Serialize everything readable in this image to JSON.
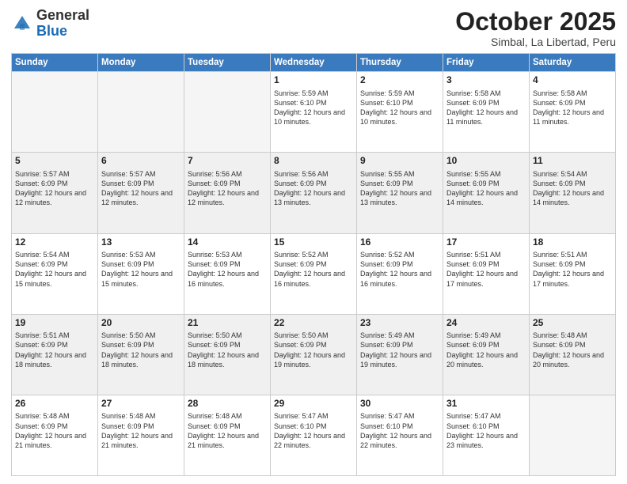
{
  "logo": {
    "general": "General",
    "blue": "Blue"
  },
  "header": {
    "month_year": "October 2025",
    "location": "Simbal, La Libertad, Peru"
  },
  "weekdays": [
    "Sunday",
    "Monday",
    "Tuesday",
    "Wednesday",
    "Thursday",
    "Friday",
    "Saturday"
  ],
  "weeks": [
    {
      "shade": false,
      "days": [
        {
          "num": "",
          "info": ""
        },
        {
          "num": "",
          "info": ""
        },
        {
          "num": "",
          "info": ""
        },
        {
          "num": "1",
          "info": "Sunrise: 5:59 AM\nSunset: 6:10 PM\nDaylight: 12 hours\nand 10 minutes."
        },
        {
          "num": "2",
          "info": "Sunrise: 5:59 AM\nSunset: 6:10 PM\nDaylight: 12 hours\nand 10 minutes."
        },
        {
          "num": "3",
          "info": "Sunrise: 5:58 AM\nSunset: 6:09 PM\nDaylight: 12 hours\nand 11 minutes."
        },
        {
          "num": "4",
          "info": "Sunrise: 5:58 AM\nSunset: 6:09 PM\nDaylight: 12 hours\nand 11 minutes."
        }
      ]
    },
    {
      "shade": true,
      "days": [
        {
          "num": "5",
          "info": "Sunrise: 5:57 AM\nSunset: 6:09 PM\nDaylight: 12 hours\nand 12 minutes."
        },
        {
          "num": "6",
          "info": "Sunrise: 5:57 AM\nSunset: 6:09 PM\nDaylight: 12 hours\nand 12 minutes."
        },
        {
          "num": "7",
          "info": "Sunrise: 5:56 AM\nSunset: 6:09 PM\nDaylight: 12 hours\nand 12 minutes."
        },
        {
          "num": "8",
          "info": "Sunrise: 5:56 AM\nSunset: 6:09 PM\nDaylight: 12 hours\nand 13 minutes."
        },
        {
          "num": "9",
          "info": "Sunrise: 5:55 AM\nSunset: 6:09 PM\nDaylight: 12 hours\nand 13 minutes."
        },
        {
          "num": "10",
          "info": "Sunrise: 5:55 AM\nSunset: 6:09 PM\nDaylight: 12 hours\nand 14 minutes."
        },
        {
          "num": "11",
          "info": "Sunrise: 5:54 AM\nSunset: 6:09 PM\nDaylight: 12 hours\nand 14 minutes."
        }
      ]
    },
    {
      "shade": false,
      "days": [
        {
          "num": "12",
          "info": "Sunrise: 5:54 AM\nSunset: 6:09 PM\nDaylight: 12 hours\nand 15 minutes."
        },
        {
          "num": "13",
          "info": "Sunrise: 5:53 AM\nSunset: 6:09 PM\nDaylight: 12 hours\nand 15 minutes."
        },
        {
          "num": "14",
          "info": "Sunrise: 5:53 AM\nSunset: 6:09 PM\nDaylight: 12 hours\nand 16 minutes."
        },
        {
          "num": "15",
          "info": "Sunrise: 5:52 AM\nSunset: 6:09 PM\nDaylight: 12 hours\nand 16 minutes."
        },
        {
          "num": "16",
          "info": "Sunrise: 5:52 AM\nSunset: 6:09 PM\nDaylight: 12 hours\nand 16 minutes."
        },
        {
          "num": "17",
          "info": "Sunrise: 5:51 AM\nSunset: 6:09 PM\nDaylight: 12 hours\nand 17 minutes."
        },
        {
          "num": "18",
          "info": "Sunrise: 5:51 AM\nSunset: 6:09 PM\nDaylight: 12 hours\nand 17 minutes."
        }
      ]
    },
    {
      "shade": true,
      "days": [
        {
          "num": "19",
          "info": "Sunrise: 5:51 AM\nSunset: 6:09 PM\nDaylight: 12 hours\nand 18 minutes."
        },
        {
          "num": "20",
          "info": "Sunrise: 5:50 AM\nSunset: 6:09 PM\nDaylight: 12 hours\nand 18 minutes."
        },
        {
          "num": "21",
          "info": "Sunrise: 5:50 AM\nSunset: 6:09 PM\nDaylight: 12 hours\nand 18 minutes."
        },
        {
          "num": "22",
          "info": "Sunrise: 5:50 AM\nSunset: 6:09 PM\nDaylight: 12 hours\nand 19 minutes."
        },
        {
          "num": "23",
          "info": "Sunrise: 5:49 AM\nSunset: 6:09 PM\nDaylight: 12 hours\nand 19 minutes."
        },
        {
          "num": "24",
          "info": "Sunrise: 5:49 AM\nSunset: 6:09 PM\nDaylight: 12 hours\nand 20 minutes."
        },
        {
          "num": "25",
          "info": "Sunrise: 5:48 AM\nSunset: 6:09 PM\nDaylight: 12 hours\nand 20 minutes."
        }
      ]
    },
    {
      "shade": false,
      "days": [
        {
          "num": "26",
          "info": "Sunrise: 5:48 AM\nSunset: 6:09 PM\nDaylight: 12 hours\nand 21 minutes."
        },
        {
          "num": "27",
          "info": "Sunrise: 5:48 AM\nSunset: 6:09 PM\nDaylight: 12 hours\nand 21 minutes."
        },
        {
          "num": "28",
          "info": "Sunrise: 5:48 AM\nSunset: 6:09 PM\nDaylight: 12 hours\nand 21 minutes."
        },
        {
          "num": "29",
          "info": "Sunrise: 5:47 AM\nSunset: 6:10 PM\nDaylight: 12 hours\nand 22 minutes."
        },
        {
          "num": "30",
          "info": "Sunrise: 5:47 AM\nSunset: 6:10 PM\nDaylight: 12 hours\nand 22 minutes."
        },
        {
          "num": "31",
          "info": "Sunrise: 5:47 AM\nSunset: 6:10 PM\nDaylight: 12 hours\nand 23 minutes."
        },
        {
          "num": "",
          "info": ""
        }
      ]
    }
  ]
}
